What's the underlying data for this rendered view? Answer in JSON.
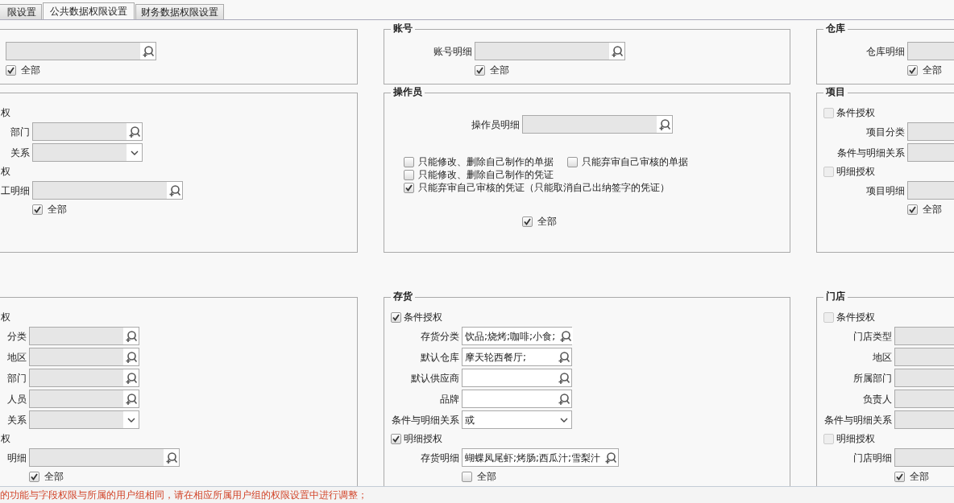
{
  "tabs": [
    {
      "label": "限设置",
      "selected": false
    },
    {
      "label": "公共数据权限设置",
      "selected": true
    },
    {
      "label": "财务数据权限设置",
      "selected": false
    }
  ],
  "panels": [
    {
      "rows": [
        {
          "kind": "detail",
          "disabled": true
        },
        {
          "kind": "all",
          "label": "全部",
          "checked": true
        }
      ]
    },
    {
      "title": "账号",
      "rows": [
        {
          "kind": "detail",
          "label": "账号明细",
          "disabled": true
        },
        {
          "kind": "all",
          "label": "全部",
          "checked": true
        }
      ]
    },
    {
      "title": "仓库",
      "rows": [
        {
          "kind": "detail",
          "label": "仓库明细",
          "disabled": true
        },
        {
          "kind": "all",
          "label": "全部",
          "checked": true
        }
      ]
    },
    {
      "rows": [
        {
          "kind": "fragment",
          "label": "权"
        },
        {
          "kind": "lookup",
          "label": "部门",
          "disabled": true
        },
        {
          "kind": "select",
          "label": "关系",
          "disabled": true
        },
        {
          "kind": "fragment",
          "label": "权"
        },
        {
          "kind": "detail",
          "label": "工明细",
          "disabled": true
        },
        {
          "kind": "all",
          "label": "全部",
          "checked": true
        }
      ]
    },
    {
      "title": "操作员",
      "rows": [
        {
          "kind": "detail",
          "label": "操作员明细",
          "disabled": true
        },
        {
          "kind": "options",
          "lines": [
            [
              {
                "label": "只能修改、删除自己制作的单据",
                "checked": false
              },
              {
                "label": "只能弃审自己审核的单据",
                "checked": false
              }
            ],
            [
              {
                "label": "只能修改、删除自己制作的凭证",
                "checked": false
              }
            ],
            [
              {
                "label": "只能弃审自己审核的凭证（只能取消自己出纳签字的凭证）",
                "checked": true
              }
            ]
          ]
        },
        {
          "kind": "all",
          "label": "全部",
          "checked": true
        }
      ]
    },
    {
      "title": "项目",
      "rows": [
        {
          "kind": "check",
          "label": "条件授权",
          "checked": false,
          "disabled": true
        },
        {
          "kind": "lookup",
          "label": "项目分类",
          "disabled": true
        },
        {
          "kind": "select",
          "label": "条件与明细关系",
          "disabled": true
        },
        {
          "kind": "check",
          "label": "明细授权",
          "checked": false,
          "disabled": true
        },
        {
          "kind": "detail",
          "label": "项目明细",
          "disabled": true
        },
        {
          "kind": "all",
          "label": "全部",
          "checked": true
        }
      ]
    },
    {
      "rows": [
        {
          "kind": "fragment",
          "label": "权"
        },
        {
          "kind": "lookup",
          "label": "分类",
          "disabled": true
        },
        {
          "kind": "lookup",
          "label": "地区",
          "disabled": true
        },
        {
          "kind": "lookup",
          "label": "部门",
          "disabled": true
        },
        {
          "kind": "lookup",
          "label": "人员",
          "disabled": true
        },
        {
          "kind": "select",
          "label": "关系",
          "disabled": true
        },
        {
          "kind": "fragment",
          "label": "权"
        },
        {
          "kind": "detail",
          "label": "明细",
          "disabled": true
        },
        {
          "kind": "all",
          "label": "全部",
          "checked": true
        }
      ]
    },
    {
      "title": "存货",
      "rows": [
        {
          "kind": "check",
          "label": "条件授权",
          "checked": true,
          "disabled": false
        },
        {
          "kind": "lookup",
          "label": "存货分类",
          "value": "饮品;烧烤;咖啡;小食;",
          "disabled": false
        },
        {
          "kind": "lookup",
          "label": "默认仓库",
          "value": "摩天轮西餐厅;",
          "disabled": false
        },
        {
          "kind": "lookup",
          "label": "默认供应商",
          "disabled": false
        },
        {
          "kind": "lookup",
          "label": "品牌",
          "disabled": false
        },
        {
          "kind": "select",
          "label": "条件与明细关系",
          "value": "或",
          "disabled": false
        },
        {
          "kind": "check",
          "label": "明细授权",
          "checked": true,
          "disabled": false
        },
        {
          "kind": "detail",
          "label": "存货明细",
          "value": "蝴蝶凤尾虾;烤肠;西瓜汁;雪梨汁",
          "disabled": false
        },
        {
          "kind": "all",
          "label": "全部",
          "checked": false
        }
      ]
    },
    {
      "title": "门店",
      "rows": [
        {
          "kind": "check",
          "label": "条件授权",
          "checked": false,
          "disabled": true
        },
        {
          "kind": "lookup",
          "label": "门店类型",
          "disabled": true
        },
        {
          "kind": "lookup",
          "label": "地区",
          "disabled": true
        },
        {
          "kind": "lookup",
          "label": "所属部门",
          "disabled": true
        },
        {
          "kind": "lookup",
          "label": "负责人",
          "disabled": true
        },
        {
          "kind": "select",
          "label": "条件与明细关系",
          "disabled": true
        },
        {
          "kind": "check",
          "label": "明细授权",
          "checked": false,
          "disabled": true
        },
        {
          "kind": "detail",
          "label": "门店明细",
          "disabled": true
        },
        {
          "kind": "all",
          "label": "全部",
          "checked": true
        }
      ]
    }
  ],
  "notice": "的功能与字段权限与所属的用户组相同，请在相应所属用户组的权限设置中进行调整；"
}
